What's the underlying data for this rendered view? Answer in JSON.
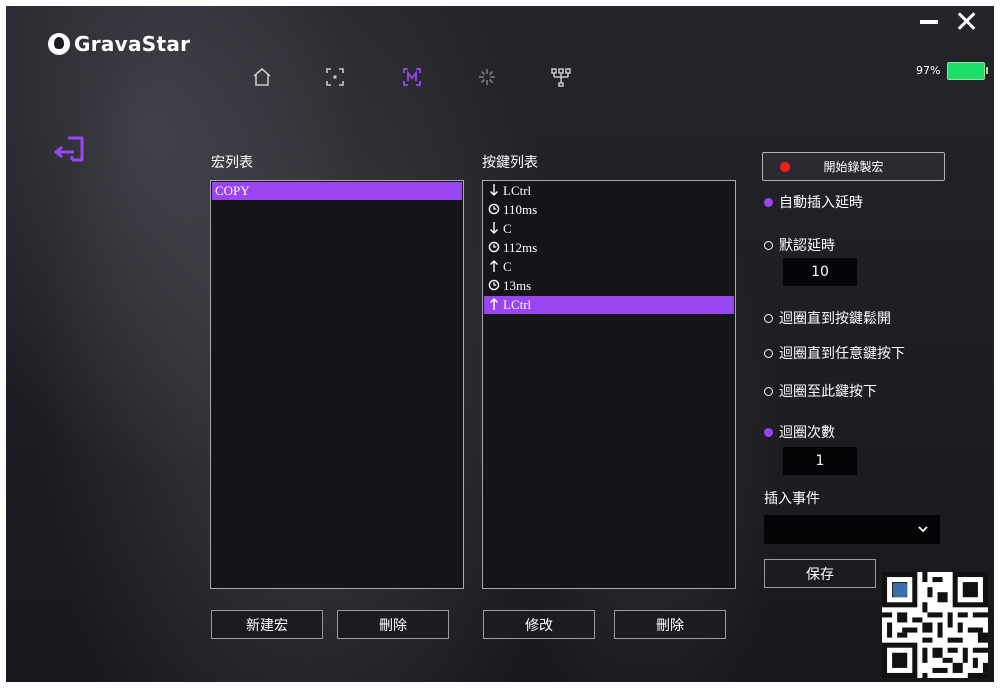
{
  "app": {
    "name": "GravaStar"
  },
  "window": {
    "minimize_icon": "minimize-icon",
    "close_glyph": "✕"
  },
  "battery": {
    "level_text": "97%",
    "level": 0.97,
    "color": "#1dde6a"
  },
  "nav": {
    "items": [
      "home-icon",
      "frame-icon",
      "macro-icon",
      "lighting-icon",
      "network-icon"
    ],
    "active": "macro-icon",
    "accent": "#9a45f2"
  },
  "macro_list": {
    "label": "宏列表",
    "items": [
      {
        "text": "COPY",
        "selected": true
      }
    ]
  },
  "key_list": {
    "label": "按鍵列表",
    "items": [
      {
        "icon": "arrow-down-icon",
        "text": "LCtrl",
        "selected": false
      },
      {
        "icon": "clock-icon",
        "text": "110ms",
        "selected": false
      },
      {
        "icon": "arrow-down-icon",
        "text": "C",
        "selected": false
      },
      {
        "icon": "clock-icon",
        "text": "112ms",
        "selected": false
      },
      {
        "icon": "arrow-up-icon",
        "text": "C",
        "selected": false
      },
      {
        "icon": "clock-icon",
        "text": "13ms",
        "selected": false
      },
      {
        "icon": "arrow-up-icon",
        "text": "LCtrl",
        "selected": true
      }
    ]
  },
  "buttons": {
    "new_macro": "新建宏",
    "delete_macro": "刪除",
    "modify": "修改",
    "delete_key": "刪除",
    "save": "保存"
  },
  "record": {
    "label": "開始錄製宏"
  },
  "options": {
    "auto_delay": {
      "label": "自動插入延時",
      "checked": true
    },
    "default_delay": {
      "label": "默認延時",
      "checked": false,
      "value": "10"
    },
    "loop_until_release": {
      "label": "迴圈直到按鍵鬆開",
      "checked": false
    },
    "loop_until_any": {
      "label": "迴圈直到任意鍵按下",
      "checked": false
    },
    "loop_until_this": {
      "label": "迴圈至此鍵按下",
      "checked": false
    },
    "loop_count": {
      "label": "迴圈次數",
      "checked": true,
      "value": "1"
    }
  },
  "insert_event": {
    "label": "插入事件",
    "value": ""
  },
  "colors": {
    "accent": "#9a45f2",
    "record": "#ff1a1a",
    "background": "#1c1d22"
  }
}
